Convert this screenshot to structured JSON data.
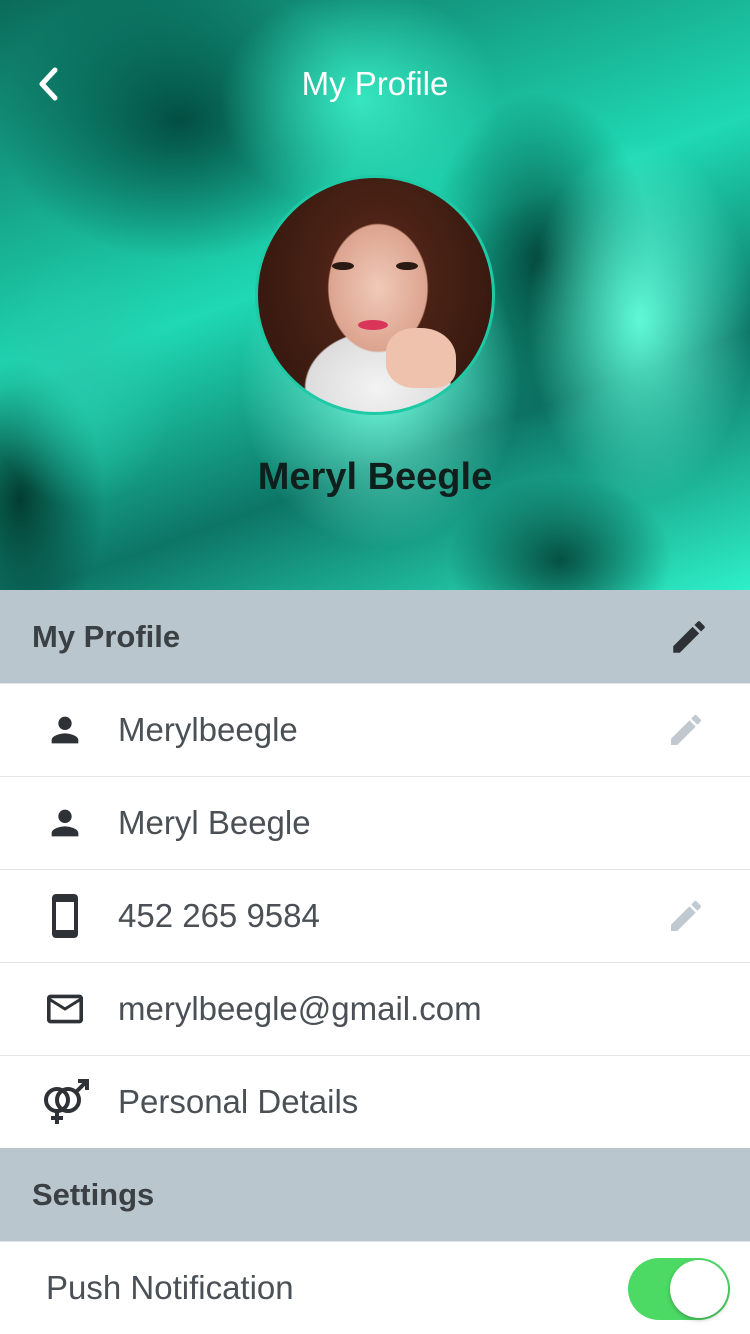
{
  "header": {
    "title": "My Profile",
    "user_name": "Meryl Beegle",
    "back_icon": "chevron-left-icon"
  },
  "profile_section": {
    "label": "My Profile",
    "edit_icon": "pencil-icon",
    "rows": [
      {
        "icon": "person-icon",
        "text": "Merylbeegle",
        "editable": true
      },
      {
        "icon": "person-icon",
        "text": "Meryl Beegle",
        "editable": false
      },
      {
        "icon": "phone-icon",
        "text": "452 265 9584",
        "editable": true
      },
      {
        "icon": "mail-icon",
        "text": "merylbeegle@gmail.com",
        "editable": false
      },
      {
        "icon": "gender-icon",
        "text": "Personal Details",
        "editable": false
      }
    ]
  },
  "settings_section": {
    "label": "Settings",
    "rows": [
      {
        "text": "Push Notification",
        "toggle_on": true
      }
    ]
  },
  "colors": {
    "section_bg": "#b9c6cd",
    "accent_teal": "#1ec9a6",
    "toggle_on": "#4cd964",
    "text_dark": "#3a4044",
    "edit_muted": "#c0c9cf"
  }
}
